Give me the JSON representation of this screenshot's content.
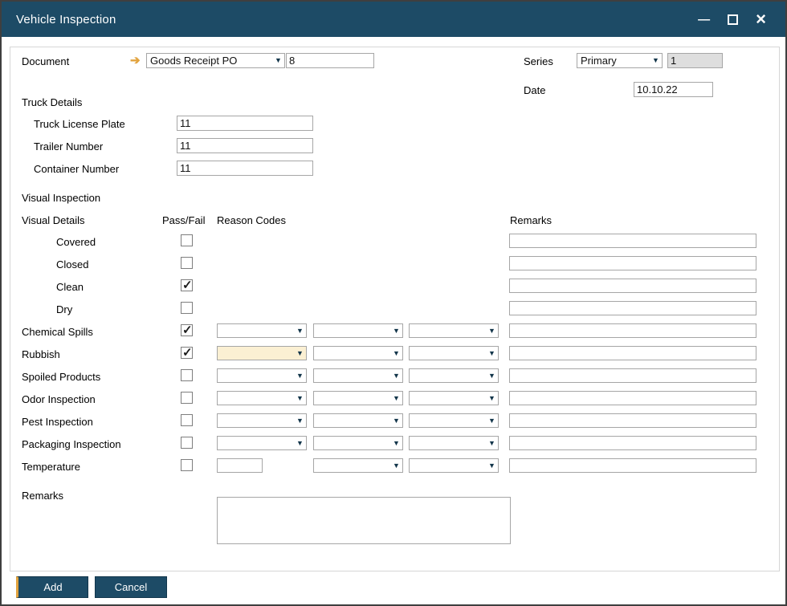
{
  "window": {
    "title": "Vehicle Inspection"
  },
  "icons": {
    "link_arrow": "➔",
    "dropdown_arrow": "▼",
    "checkmark": "✓",
    "minimize": "—",
    "close": "×"
  },
  "colors": {
    "titlebar": "#1d4b66",
    "accent_gold": "#e2a33e",
    "focus_field": "#fbf0d3",
    "button": "#1d4b66",
    "disabled_field": "#dedede"
  },
  "header": {
    "document_label": "Document",
    "document_type": "Goods Receipt PO",
    "document_number": "8",
    "series_label": "Series",
    "series_value": "Primary",
    "series_number": "1",
    "date_label": "Date",
    "date_value": "10.10.22"
  },
  "truck_details": {
    "section_label": "Truck Details",
    "fields": [
      {
        "label": "Truck License Plate",
        "value": "11"
      },
      {
        "label": "Trailer Number",
        "value": "11"
      },
      {
        "label": "Container Number",
        "value": "11"
      }
    ]
  },
  "visual_inspection": {
    "section_label": "Visual Inspection",
    "col_visual_details": "Visual Details",
    "col_pass_fail": "Pass/Fail",
    "col_reason_codes": "Reason Codes",
    "col_remarks": "Remarks",
    "rows": [
      {
        "label": "Covered",
        "checked": false,
        "remarks": ""
      },
      {
        "label": "Closed",
        "checked": false,
        "remarks": ""
      },
      {
        "label": "Clean",
        "checked": true,
        "remarks": ""
      },
      {
        "label": "Dry",
        "checked": false,
        "remarks": ""
      },
      {
        "label": "Chemical Spills",
        "checked": true,
        "reason_codes": [
          "",
          "",
          ""
        ],
        "remarks": ""
      },
      {
        "label": "Rubbish",
        "checked": true,
        "reason_codes": [
          "",
          "",
          ""
        ],
        "remarks": ""
      },
      {
        "label": "Spoiled Products",
        "checked": false,
        "reason_codes": [
          "",
          "",
          ""
        ],
        "remarks": ""
      },
      {
        "label": "Odor Inspection",
        "checked": false,
        "reason_codes": [
          "",
          "",
          ""
        ],
        "remarks": ""
      },
      {
        "label": "Pest Inspection",
        "checked": false,
        "reason_codes": [
          "",
          "",
          ""
        ],
        "remarks": ""
      },
      {
        "label": "Packaging Inspection",
        "checked": false,
        "reason_codes": [
          "",
          "",
          ""
        ],
        "remarks": ""
      },
      {
        "label": "Temperature",
        "checked": false,
        "value": "",
        "reason_codes": [
          "",
          ""
        ],
        "remarks": ""
      }
    ]
  },
  "remarks_section": {
    "label": "Remarks",
    "value": ""
  },
  "buttons": {
    "add": "Add",
    "cancel": "Cancel"
  }
}
